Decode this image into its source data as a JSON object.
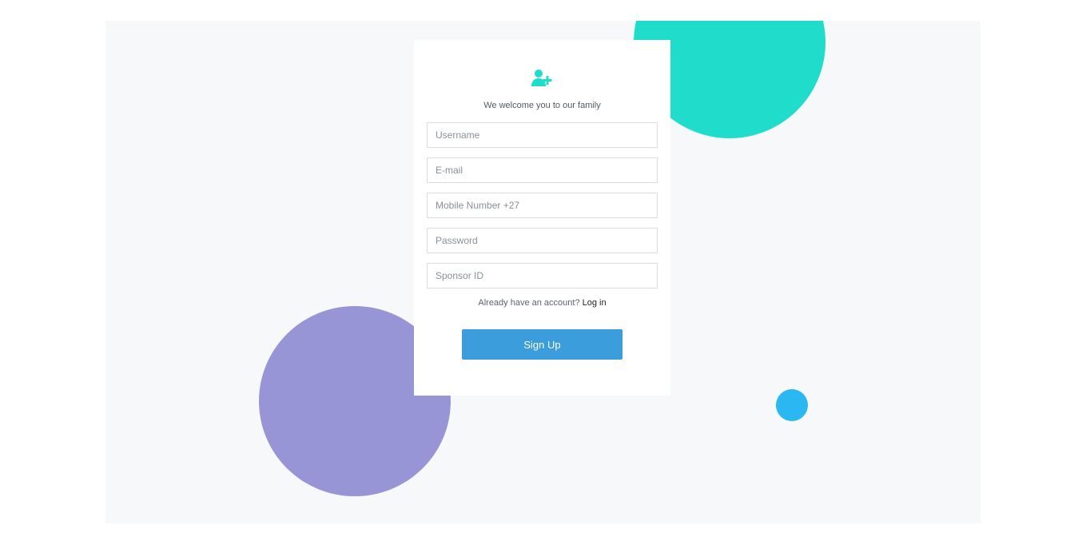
{
  "colors": {
    "accent_teal": "#1fddca",
    "purple": "#9795d6",
    "blue": "#2bb8f2",
    "button": "#3b9ddb",
    "background": "#f7f8fa"
  },
  "card": {
    "icon": "user-plus-icon",
    "welcome_text": "We welcome you to our family"
  },
  "form": {
    "username": {
      "placeholder": "Username",
      "value": ""
    },
    "email": {
      "placeholder": "E-mail",
      "value": ""
    },
    "mobile": {
      "placeholder": "Mobile Number +27",
      "value": ""
    },
    "password": {
      "placeholder": "Password",
      "value": ""
    },
    "sponsor": {
      "placeholder": "Sponsor ID",
      "value": ""
    }
  },
  "login_prompt": {
    "text": "Already have an account?",
    "link_label": "Log in"
  },
  "signup_button": {
    "label": "Sign Up"
  }
}
